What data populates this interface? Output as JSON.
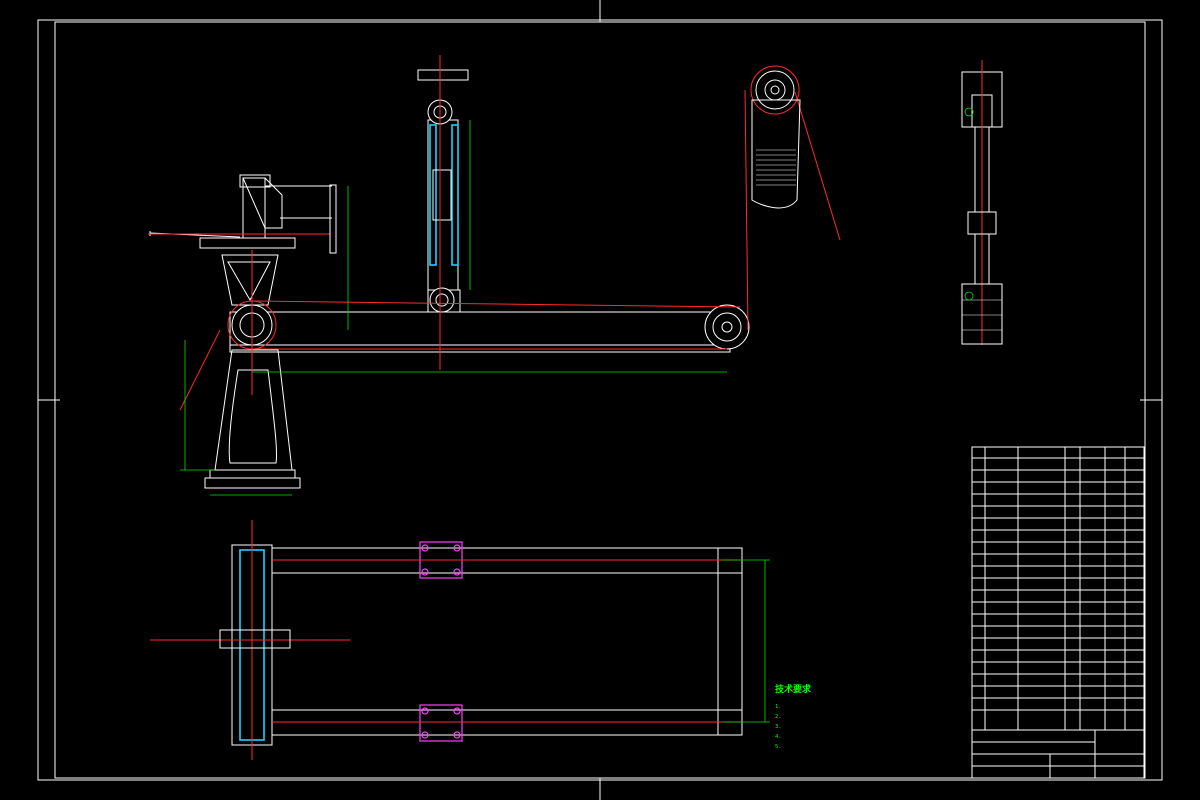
{
  "technical_requirements": {
    "heading": "技术要求",
    "items": [
      "1.",
      "2.",
      "3.",
      "4.",
      "5."
    ]
  },
  "colors": {
    "background": "#000000",
    "outline": "#ffffff",
    "belt_and_centerlines": "#ff2a2a",
    "dimensions": "#00e000",
    "section_fill": "#20d0ff",
    "bolts": "#ff40ff"
  }
}
